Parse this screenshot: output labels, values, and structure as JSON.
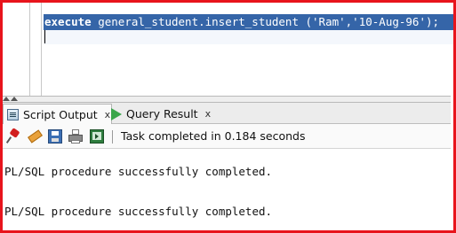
{
  "editor": {
    "keyword": "execute",
    "statement": " general_student.insert_student ('Ram','10-Aug-96');"
  },
  "tabs": [
    {
      "label": "Script Output",
      "close": "x",
      "icon": "script-output-icon",
      "active": true
    },
    {
      "label": "Query Result",
      "close": "x",
      "icon": "run-triangle-icon",
      "active": false
    }
  ],
  "toolbar": {
    "buttons": [
      "pin-icon",
      "clear-eraser-icon",
      "save-icon",
      "print-icon",
      "open-console-icon"
    ],
    "status": "Task completed in 0.184 seconds"
  },
  "output": {
    "lines": [
      "PL/SQL procedure successfully completed.",
      "PL/SQL procedure successfully completed."
    ]
  },
  "colors": {
    "frame_border": "#e8141c",
    "selection": "#3565a8",
    "run_icon": "#3aa64a"
  }
}
